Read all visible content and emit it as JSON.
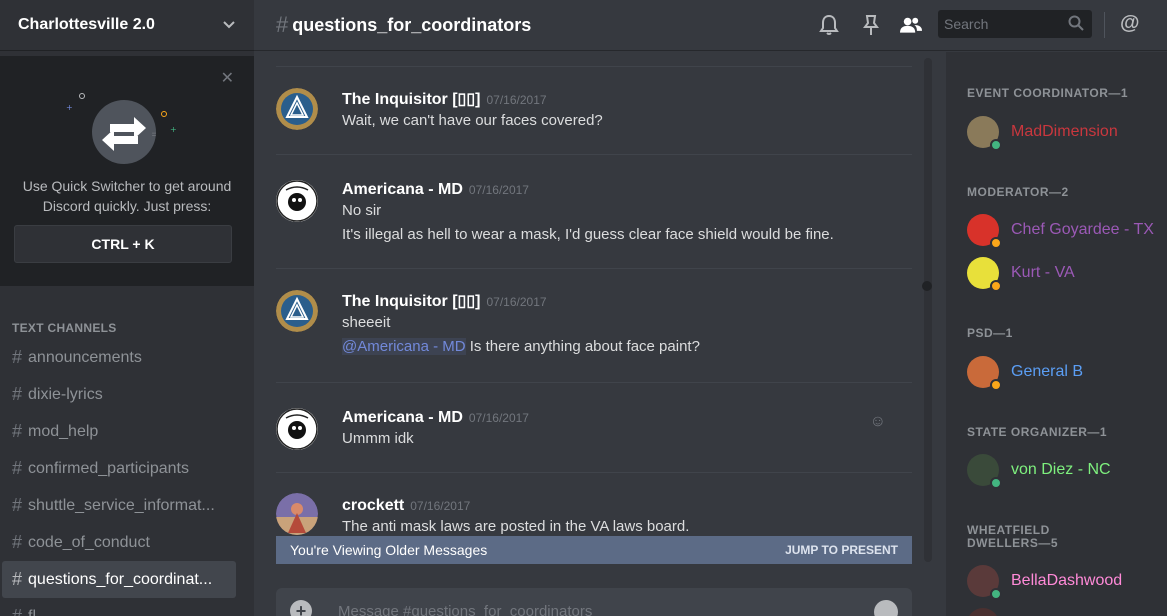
{
  "sidebar": {
    "guild_name": "Charlottesville 2.0",
    "quick_switcher": {
      "text": "Use Quick Switcher to get around Discord quickly. Just press:",
      "key": "CTRL + K"
    },
    "category": "TEXT CHANNELS",
    "channels": [
      {
        "name": "announcements"
      },
      {
        "name": "dixie-lyrics"
      },
      {
        "name": "mod_help"
      },
      {
        "name": "confirmed_participants"
      },
      {
        "name": "shuttle_service_informat..."
      },
      {
        "name": "code_of_conduct"
      },
      {
        "name": "questions_for_coordinat...",
        "active": true
      },
      {
        "name": "fl..."
      }
    ]
  },
  "header": {
    "channel_name": "questions_for_coordinators",
    "search_placeholder": "Search"
  },
  "messages": [
    {
      "author": "The Inquisitor [▯▯]",
      "timestamp": "07/16/2017",
      "lines": [
        "Wait, we can't have our faces covered?"
      ]
    },
    {
      "author": "Americana - MD",
      "timestamp": "07/16/2017",
      "lines": [
        "No sir",
        "It's illegal as hell to wear a mask, I'd guess clear face shield would be fine."
      ]
    },
    {
      "author": "The Inquisitor [▯▯]",
      "timestamp": "07/16/2017",
      "lines": [
        "sheeeit"
      ],
      "mention": "@Americana - MD",
      "mention_text": " Is there anything about face paint?"
    },
    {
      "author": "Americana - MD",
      "timestamp": "07/16/2017",
      "lines": [
        "Ummm idk"
      ]
    },
    {
      "author": "crockett",
      "timestamp": "07/16/2017",
      "lines": [
        "The anti mask laws are posted in the VA laws board."
      ]
    }
  ],
  "older_bar": {
    "text": "You're Viewing Older Messages",
    "jump": "JUMP TO PRESENT"
  },
  "composer": {
    "placeholder": "Message #questions_for_coordinators"
  },
  "members": {
    "roles": [
      {
        "title": "EVENT COORDINATOR—1",
        "members": [
          {
            "name": "MadDimension",
            "color": "#c9373e",
            "status": "online"
          }
        ]
      },
      {
        "title": "MODERATOR—2",
        "members": [
          {
            "name": "Chef Goyardee - TX",
            "color": "#9b59b6",
            "status": "idle"
          },
          {
            "name": "Kurt - VA",
            "color": "#9b59b6",
            "status": "idle"
          }
        ]
      },
      {
        "title": "PSD—1",
        "members": [
          {
            "name": "General B",
            "color": "#5b9ef5",
            "status": "idle"
          }
        ]
      },
      {
        "title": "STATE ORGANIZER—1",
        "members": [
          {
            "name": "von Diez - NC",
            "color": "#7ef07e",
            "status": "online"
          }
        ]
      },
      {
        "title": "WHEATFIELD DWELLERS—5",
        "members": [
          {
            "name": "BellaDashwood",
            "color": "#ff8ad8",
            "status": "online"
          }
        ]
      }
    ]
  },
  "colors": {
    "online": "#43b581",
    "idle": "#faa61a"
  }
}
